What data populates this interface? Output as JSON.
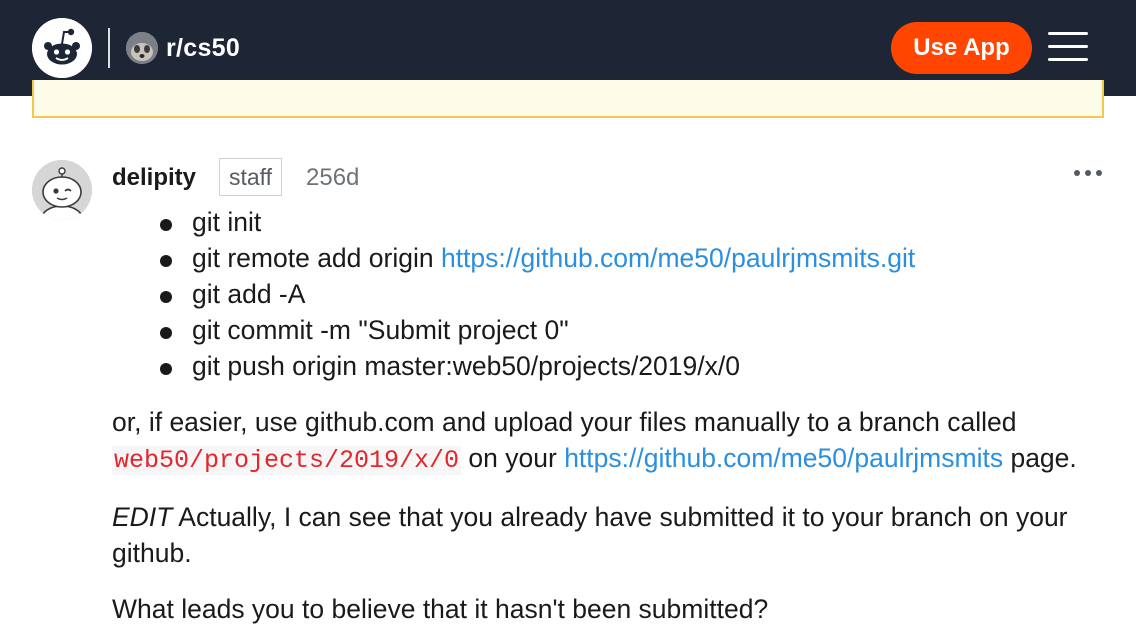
{
  "header": {
    "subreddit": "r/cs50",
    "use_app_label": "Use App"
  },
  "comment": {
    "author": "delipity",
    "flair": "staff",
    "age": "256d",
    "steps": [
      {
        "text": "git init",
        "link": ""
      },
      {
        "text": "git remote add origin ",
        "link": "https://github.com/me50/paulrjmsmits.git"
      },
      {
        "text": "git add -A",
        "link": ""
      },
      {
        "text": "git commit -m \"Submit project 0\"",
        "link": ""
      },
      {
        "text": "git push origin master:web50/projects/2019/x/0",
        "link": ""
      }
    ],
    "para1": {
      "before": "or, if easier, use github.com and upload your files manually to a branch called ",
      "code": "web50/projects/2019/x/0",
      "middle": " on your ",
      "link": "https://github.com/me50/paulrjmsmits",
      "after": " page."
    },
    "para2": {
      "em": "EDIT",
      "text": " Actually, I can see that you already have submitted it to your branch on your github."
    },
    "para3": "What leads you to believe that it hasn't been submitted?"
  },
  "colors": {
    "header_bg": "#1e2534",
    "accent": "#ff4500",
    "link": "#2a8fe0",
    "code": "#e3262c"
  },
  "icons": {
    "logo": "reddit-snoo-icon",
    "subreddit": "subreddit-avatar-icon",
    "menu": "hamburger-menu-icon",
    "avatar": "user-avatar-icon",
    "more": "more-options-icon"
  }
}
